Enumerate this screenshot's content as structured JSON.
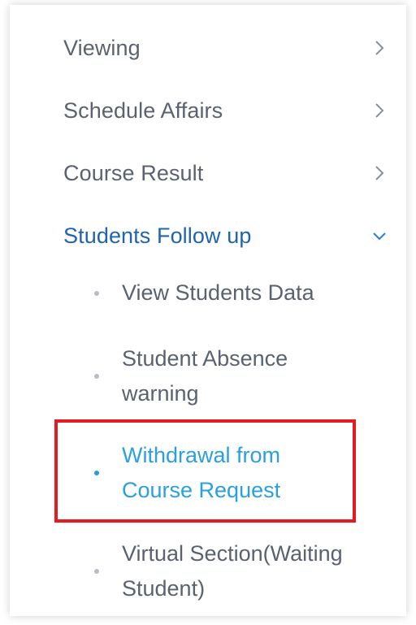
{
  "menu": [
    {
      "label": "Viewing",
      "chevron": "chevron-right-icon"
    },
    {
      "label": "Schedule Affairs",
      "chevron": "chevron-right-icon"
    },
    {
      "label": "Course Result",
      "chevron": "chevron-right-icon"
    },
    {
      "label": "Students Follow up",
      "chevron": "chevron-down-icon",
      "expanded": true
    }
  ],
  "submenu": [
    {
      "line1": "View Students Data",
      "line2": ""
    },
    {
      "line1": "Student Absence",
      "line2": "warning"
    },
    {
      "line1": "Withdrawal from",
      "line2": "Course Request",
      "active": true
    },
    {
      "line1": "Virtual Section(Waiting",
      "line2": "Student)"
    }
  ],
  "colors": {
    "text": "#5a6270",
    "active_parent": "#1f64b0",
    "active_child": "#2aa0e0",
    "highlight_border": "#e41b23"
  }
}
